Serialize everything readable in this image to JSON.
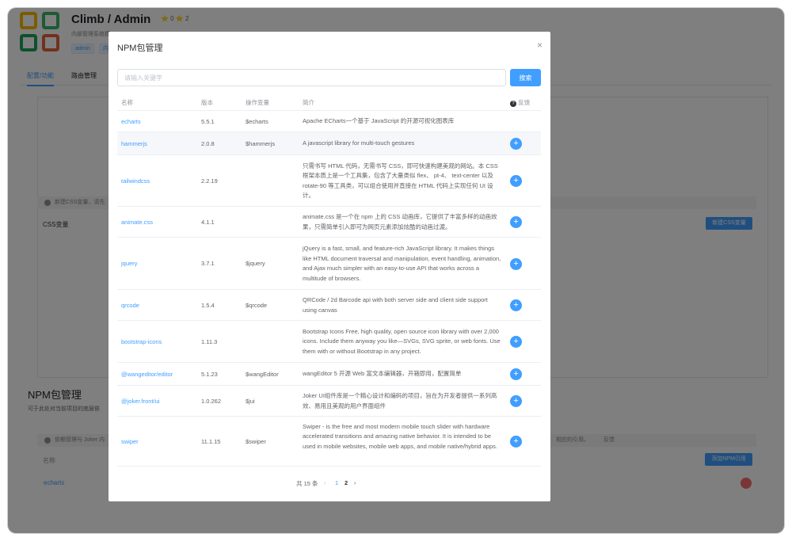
{
  "app": {
    "title": "Climb / Admin",
    "stats": "⭐ 0  ⭐ 2",
    "subtitle": "内部管理系统模",
    "tags": [
      "admin",
      "内"
    ],
    "tabs": [
      "配置/功能",
      "路由管理"
    ],
    "alert1": "新建CSS变量，请先",
    "css_label": "CSS变量",
    "new_css_btn": "新建CSS变量",
    "npm_heading": "NPM包管理",
    "npm_desc": "可于此处对当前项目的底层依",
    "alert2": "依赖管理与 Joker 内",
    "alert2_right": "相应的引用。",
    "feedback_bg": "反馈",
    "col_name_bg": "名称",
    "add_npm_btn": "添加NPM引用",
    "echarts_bg": "echarts"
  },
  "modal": {
    "title": "NPM包管理",
    "close": "×",
    "search_placeholder": "请输入关键字",
    "search_btn": "搜索",
    "columns": {
      "name": "名称",
      "version": "版本",
      "var": "操作变量",
      "desc": "简介",
      "feedback": "反馈"
    },
    "rows": [
      {
        "name": "echarts",
        "version": "5.5.1",
        "var": "$echarts",
        "desc": "Apache ECharts一个基于 JavaScript 的开源可视化图表库",
        "add": false
      },
      {
        "name": "hammerjs",
        "version": "2.0.8",
        "var": "$hammerjs",
        "desc": "A javascript library for multi-touch gestures",
        "add": true
      },
      {
        "name": "tailwindcss",
        "version": "2.2.19",
        "var": "",
        "desc": "只需书写 HTML 代码，无需书写 CSS，即可快速构建美观的网站。本 CSS 框架本质上是一个工具集，包含了大量类似 flex、 pt-4、 text-center 以及 rotate-90 等工具类，可以组合使用并直接在 HTML 代码上实现任何 UI 设计。",
        "add": true
      },
      {
        "name": "animate.css",
        "version": "4.1.1",
        "var": "",
        "desc": "animate.css 是一个在 npm 上的 CSS 动画库，它提供了丰富多样的动画效果，只需简单引入即可为网页元素添加炫酷的动画过渡。",
        "add": true
      },
      {
        "name": "jquery",
        "version": "3.7.1",
        "var": "$jquery",
        "desc": "jQuery is a fast, small, and feature-rich JavaScript library. It makes things like HTML document traversal and manipulation, event handling, animation, and Ajax much simpler with an easy-to-use API that works across a multitude of browsers.",
        "add": true
      },
      {
        "name": "qrcode",
        "version": "1.5.4",
        "var": "$qrcode",
        "desc": "QRCode / 2d Barcode api with both server side and client side support using canvas",
        "add": true
      },
      {
        "name": "bootstrap-icons",
        "version": "1.11.3",
        "var": "",
        "desc": "Bootstrap Icons Free, high quality, open source icon library with over 2,000 icons. Include them anyway you like—SVGs, SVG sprite, or web fonts. Use them with or without Bootstrap in any project.",
        "add": true
      },
      {
        "name": "@wangeditor/editor",
        "version": "5.1.23",
        "var": "$wangEditor",
        "desc": "wangEditor 5 开源 Web 富文本编辑器，开箱即用，配置简单",
        "add": true
      },
      {
        "name": "@joker.front/ui",
        "version": "1.0.262",
        "var": "$jui",
        "desc": "Joker UI组件库是一个精心设计和编码的项目，旨在为开发者提供一系列高效、易用且美观的用户界面组件",
        "add": true
      },
      {
        "name": "swiper",
        "version": "11.1.15",
        "var": "$swiper",
        "desc": "Swiper - is the free and most modern mobile touch slider with hardware accelerated transitions and amazing native behavior. It is intended to be used in mobile websites, mobile web apps, and mobile native/hybrid apps.",
        "add": true
      }
    ],
    "pager": {
      "total": "共 15 条",
      "prev": "‹",
      "pages": [
        "1",
        "2"
      ],
      "next": "›"
    }
  },
  "colors": {
    "accent": "#409eff",
    "mask": "rgba(0,0,0,0.5)"
  },
  "icons": [
    "logo-icon",
    "close-icon",
    "question-icon",
    "plus-icon",
    "chevron-left-icon",
    "chevron-right-icon",
    "info-icon"
  ]
}
